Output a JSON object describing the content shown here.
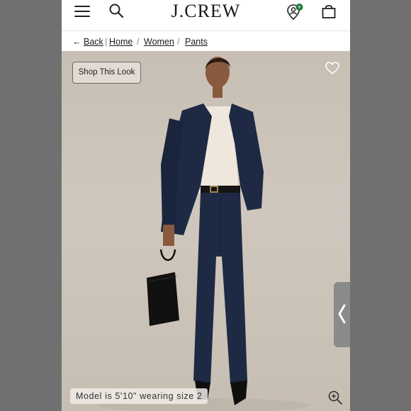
{
  "header": {
    "brand": "J.CREW",
    "icons": [
      "menu-icon",
      "search-icon",
      "account-icon",
      "shopping-bag-icon"
    ],
    "account_badge": "+"
  },
  "breadcrumb": {
    "back_label": "Back",
    "items": [
      "Home",
      "Women",
      "Pants"
    ],
    "separator": "/"
  },
  "hero": {
    "shop_look_label": "Shop This Look",
    "model_caption": "Model is 5'10\" wearing size 2",
    "icons": [
      "heart-icon",
      "chevron-left-icon",
      "zoom-in-icon"
    ]
  },
  "colors": {
    "backdrop": "#c8bfb4",
    "suit_navy": "#1e2a44",
    "badge_green": "#1f7a3a",
    "frame_gray": "#707070"
  }
}
